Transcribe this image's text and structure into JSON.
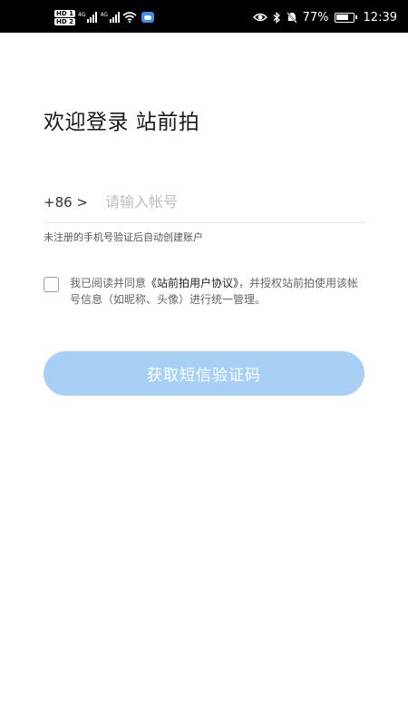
{
  "status_bar": {
    "hd1": "HD 1",
    "hd2": "HD 2",
    "net1": "4G",
    "net2": "4G",
    "battery_percent": "77%",
    "time": "12:39",
    "icons": [
      "signal-icon",
      "wifi-icon",
      "cloud-icon",
      "eye-icon",
      "bluetooth-icon",
      "mute-icon",
      "battery-icon"
    ]
  },
  "page": {
    "title": "欢迎登录 站前拍"
  },
  "login": {
    "country_code": "+86 >",
    "phone_placeholder": "请输入帐号",
    "hint": "未注册的手机号验证后自动创建账户"
  },
  "agreement": {
    "prefix": "我已阅读并同意",
    "link": "《站前拍用户协议》",
    "suffix": "，并授权站前拍使用该帐号信息（如昵称、头像）进行统一管理。"
  },
  "actions": {
    "get_code": "获取短信验证码"
  },
  "colors": {
    "button_bg": "#a8d0f5",
    "status_bar_bg": "#000000"
  }
}
